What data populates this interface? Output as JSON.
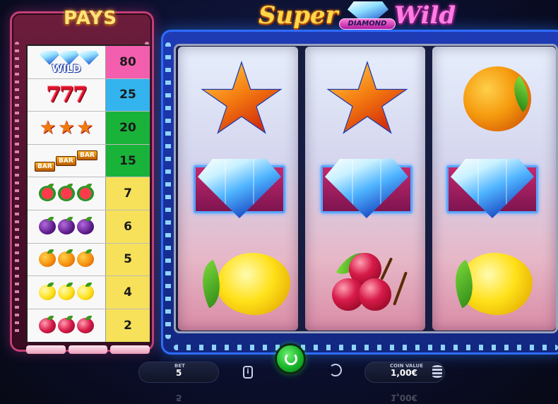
{
  "logo": {
    "super": "Super",
    "diamond": "DIAMOND",
    "wild": "Wild"
  },
  "pays": {
    "title": "PAYS",
    "rows": [
      {
        "symbol": "wild-diamond",
        "label": "WILD",
        "value": "80",
        "color": "#f35fae"
      },
      {
        "symbol": "seven",
        "label": "777",
        "value": "25",
        "color": "#33b4ee"
      },
      {
        "symbol": "star",
        "value": "20",
        "color": "#19b33a"
      },
      {
        "symbol": "bar",
        "label": "BAR",
        "value": "15",
        "color": "#19b33a"
      },
      {
        "symbol": "watermelon",
        "value": "7",
        "color": "#f7e15a"
      },
      {
        "symbol": "plum",
        "value": "6",
        "color": "#f7e15a"
      },
      {
        "symbol": "orange",
        "value": "5",
        "color": "#f7e15a"
      },
      {
        "symbol": "lemon",
        "value": "4",
        "color": "#f7e15a"
      },
      {
        "symbol": "cherry",
        "value": "2",
        "color": "#f7e15a"
      }
    ]
  },
  "reels": [
    [
      "star",
      "diamond",
      "lemon"
    ],
    [
      "star",
      "diamond",
      "cherry"
    ],
    [
      "orange",
      "diamond",
      "lemon"
    ]
  ],
  "controls": {
    "bet_label": "BET",
    "bet_value": "5",
    "coin_label": "COIN VALUE",
    "coin_value": "1,00€",
    "info_icon": "info-icon",
    "spin_icon": "spin-arrow-icon",
    "autoplay_icon": "autoplay-icon",
    "coins_icon": "coins-stack-icon"
  }
}
